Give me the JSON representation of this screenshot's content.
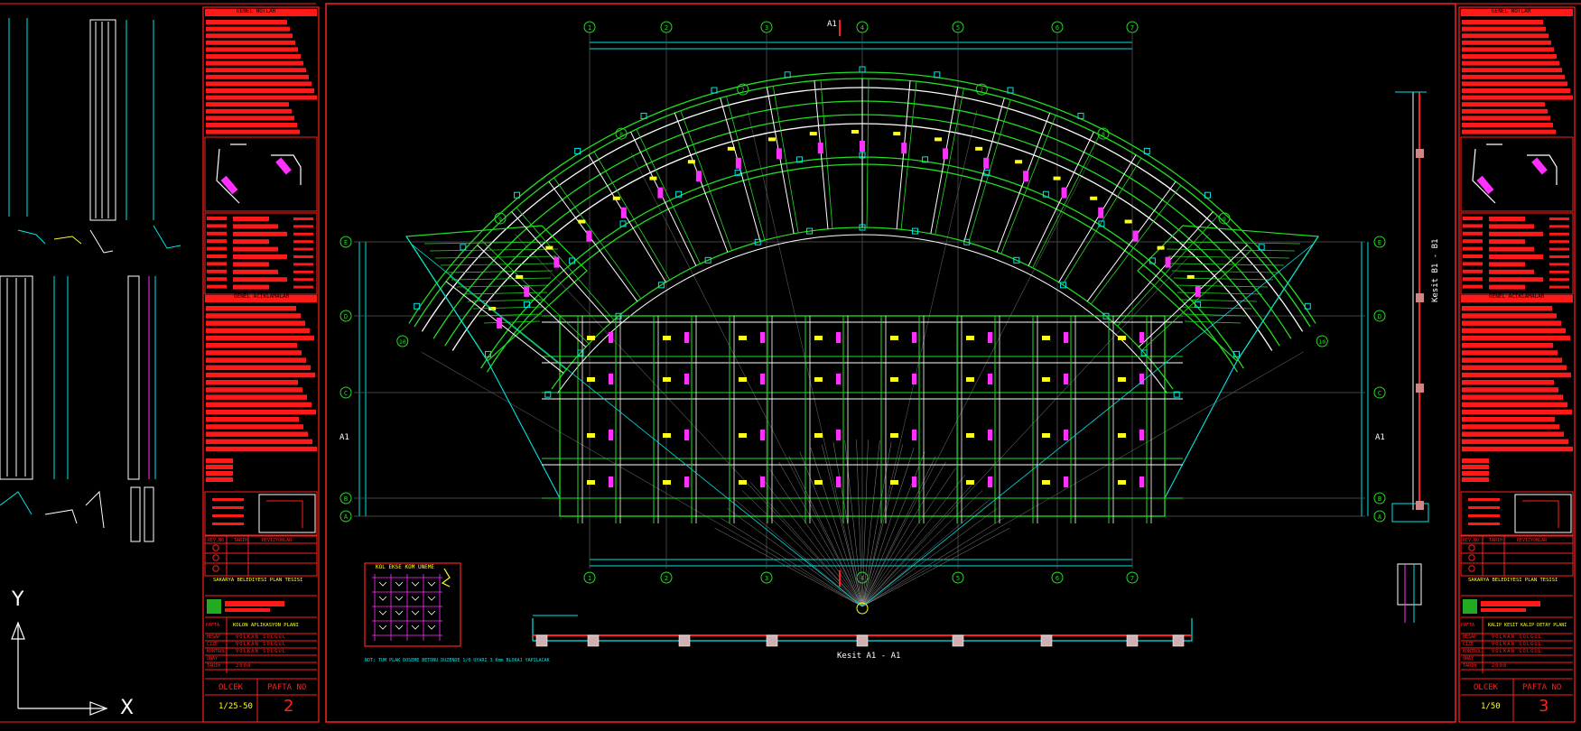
{
  "grid": {
    "top_axes": [
      "1",
      "2",
      "3",
      "4",
      "5",
      "6",
      "7"
    ],
    "radial_axes_left": [
      "10",
      "9",
      "8",
      "7"
    ],
    "radial_axes_right": [
      "10",
      "9",
      "8",
      "7"
    ],
    "row_axes": [
      "E",
      "D",
      "C",
      "B",
      "A"
    ]
  },
  "labels": {
    "section_a_marker": "A1",
    "section_b_vertical": "Kesit B1 - B1",
    "section_a_caption": "Kesit A1 - A1",
    "side_left": "A1",
    "side_right": "A1",
    "detail_title": "KOL EKSE KOM UNEME",
    "bottom_note": "NOT: TUM PLAK DOSEME BETONU DUZENDE 1/0 UYARI 3 Kmm BLOKAJ YAPILACAK",
    "ucs_y": "Y",
    "ucs_x": "X"
  },
  "title_block_left": {
    "genel_notlar": "GENEL NOTLAR",
    "genel_aciklamalar": "GENEL ACIKLAMALAR",
    "revizyon_headers": [
      "REV.NO",
      "TARIH",
      "REVIZYONLAR"
    ],
    "project": "SAKARYA BELEDIYESI PLAN TESISI",
    "pafta_label": "PAFTA",
    "pafta_title": "KOLON APLIKASYON PLANI",
    "people_rows": [
      {
        "role": "HESAP",
        "name": "VOLKAN SOLGUL"
      },
      {
        "role": "CIZE",
        "name": "VOLKAN SOLGUL"
      },
      {
        "role": "KONTROL",
        "name": "VOLKAN SOLGUL"
      },
      {
        "role": "ONAY",
        "name": ""
      },
      {
        "role": "TARIH",
        "name": "2008"
      }
    ],
    "olcek_label": "OLCEK",
    "pafta_no_label": "PAFTA NO",
    "olcek_value": "1/25-50",
    "pafta_no_value": "2"
  },
  "title_block_right": {
    "genel_notlar": "GENEL NOTLAR",
    "genel_aciklamalar": "GENEL ACIKLAMALAR",
    "revizyon_headers": [
      "REV.NO",
      "TARIH",
      "REVIZYONLAR"
    ],
    "project": "SAKARYA BELEDIYESI PLAN TESISI",
    "pafta_label": "PAFTA",
    "pafta_title": "KALIP KESIT KALIP DETAY PLANI",
    "people_rows": [
      {
        "role": "HESAP",
        "name": "VOLKAN SOLGUL"
      },
      {
        "role": "CIZE",
        "name": "VOLKAN SOLGUL"
      },
      {
        "role": "KONTROL",
        "name": "VOLKAN SOLGUL"
      },
      {
        "role": "ONAY",
        "name": ""
      },
      {
        "role": "TARIH",
        "name": "2008"
      }
    ],
    "olcek_label": "OLCEK",
    "pafta_no_label": "PAFTA NO",
    "olcek_value": "1/50",
    "pafta_no_value": "3"
  },
  "colors": {
    "background": "#000000",
    "frame": "#ff2020",
    "grid": "#00e5e5",
    "beam": "#22dd22",
    "column_bar": "#ffffff",
    "rebar": "#ff30ff",
    "tag": "#ffff20",
    "title_fill": "#ff1a1a"
  }
}
